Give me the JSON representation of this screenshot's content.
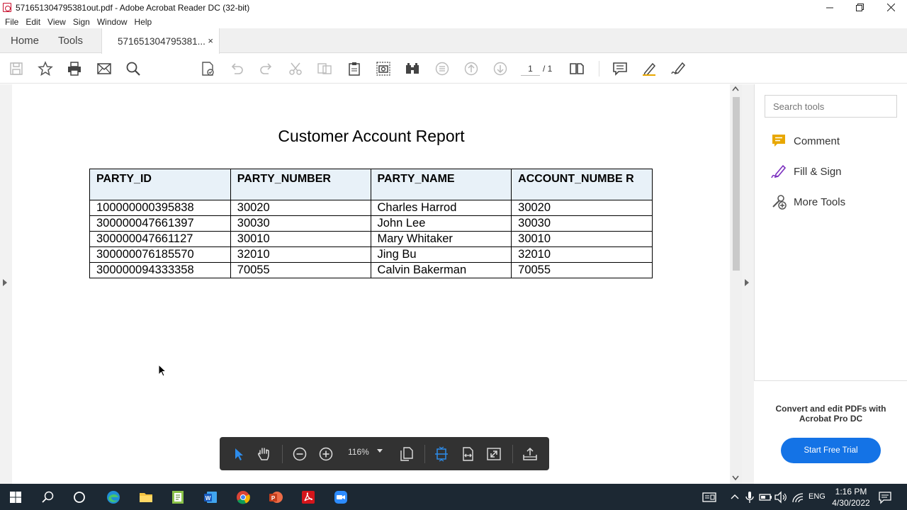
{
  "window": {
    "title": "571651304795381out.pdf - Adobe Acrobat Reader DC (32-bit)"
  },
  "menu": [
    "File",
    "Edit",
    "View",
    "Sign",
    "Window",
    "Help"
  ],
  "tabs": {
    "home": "Home",
    "tools": "Tools",
    "document": "571651304795381...",
    "close_glyph": "×"
  },
  "toolbar": {
    "page_current": "1",
    "page_total": "/ 1"
  },
  "document": {
    "title": "Customer Account Report",
    "columns": [
      "PARTY_ID",
      "PARTY_NUMBER",
      "PARTY_NAME",
      "ACCOUNT_NUMBE R"
    ],
    "rows": [
      [
        "100000000395838",
        "30020",
        "Charles Harrod",
        "30020"
      ],
      [
        "300000047661397",
        "30030",
        "John Lee",
        "30030"
      ],
      [
        "300000047661127",
        "30010",
        "Mary Whitaker",
        "30010"
      ],
      [
        "300000076185570",
        "32010",
        "Jing Bu",
        "32010"
      ],
      [
        "300000094333358",
        "70055",
        "Calvin Bakerman",
        "70055"
      ]
    ]
  },
  "right_panel": {
    "search_placeholder": "Search tools",
    "tools": [
      {
        "label": "Comment",
        "icon": "comment-icon",
        "color": "#e8a700"
      },
      {
        "label": "Fill & Sign",
        "icon": "fill-sign-icon",
        "color": "#7b2fbf"
      },
      {
        "label": "More Tools",
        "icon": "more-tools-icon",
        "color": "#555555"
      }
    ],
    "promo_text": "Convert and edit PDFs with Acrobat Pro DC",
    "trial_button": "Start Free Trial"
  },
  "floating_toolbar": {
    "zoom": "116%"
  },
  "taskbar": {
    "language": "ENG",
    "time": "1:16 PM",
    "date": "4/30/2022"
  },
  "colors": {
    "accent": "#1473e6",
    "table_header": "#e8f1f8",
    "acrobat_red": "#c8102e"
  }
}
